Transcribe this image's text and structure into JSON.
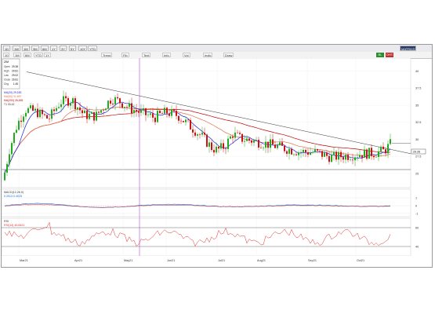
{
  "header": {
    "interval_tabs": [
      "1D",
      "1W",
      "1M",
      "3M",
      "6M",
      "1Y",
      "3Y",
      "5Y",
      "10Y",
      "YTD"
    ],
    "range_buttons": [
      "10",
      "1M",
      "6M",
      "YTD",
      "1Y"
    ],
    "toolbar_buttons": [
      "Trend",
      "Fib",
      "Text",
      "Info",
      "Vol",
      "Indic",
      "Draw"
    ],
    "status_swatches": [
      {
        "label": "BL",
        "color": "#2e8b2e"
      },
      {
        "label": "OHT",
        "color": "#c03030"
      }
    ],
    "right_label": "MATRIXS"
  },
  "quote": {
    "symbol": "ZIM",
    "rows": [
      {
        "label": "Open",
        "value": "29.38"
      },
      {
        "label": "High",
        "value": "29.81"
      },
      {
        "label": "Low",
        "value": "29.02"
      },
      {
        "label": "Close",
        "value": "29.81"
      },
      {
        "label": "Chg",
        "value": "1.45"
      }
    ]
  },
  "indicator_labels": [
    {
      "text": "MA(20)  29.183",
      "color": "#1a1adc"
    },
    {
      "text": "MA(50)  31.697",
      "color": "#e0704a"
    },
    {
      "text": "MA(200) 26.455",
      "color": "#c00000"
    },
    {
      "text": "T1 33.42",
      "color": "#333333"
    }
  ],
  "price_axis": {
    "ticks": [
      "40",
      "37.5",
      "35",
      "32.5",
      "30",
      "27.5",
      "25"
    ],
    "last_price": "29.26"
  },
  "x_axis": {
    "labels": [
      "Mar21",
      "Apr21",
      "May21",
      "Jun21",
      "Jul21",
      "Aug21",
      "Sep21",
      "Oct21"
    ]
  },
  "macd": {
    "title": "MACD(12,26,9)",
    "values": "0.2513  0.4025",
    "ticks": [
      "1",
      "0",
      "-1"
    ]
  },
  "rsi": {
    "title": "RSI",
    "values": "RSI(14)  45.6421",
    "ticks": [
      "60",
      "40"
    ]
  },
  "colors": {
    "candle_up": "#22aa22",
    "candle_down": "#cc1111",
    "ma20": "#1a1adc",
    "ma50": "#e0704a",
    "ma200": "#c00000",
    "trendline": "#333333",
    "vertical_marker": "#b44bd8",
    "macd": "#1a6ad8",
    "rsi": "#e03030"
  }
}
